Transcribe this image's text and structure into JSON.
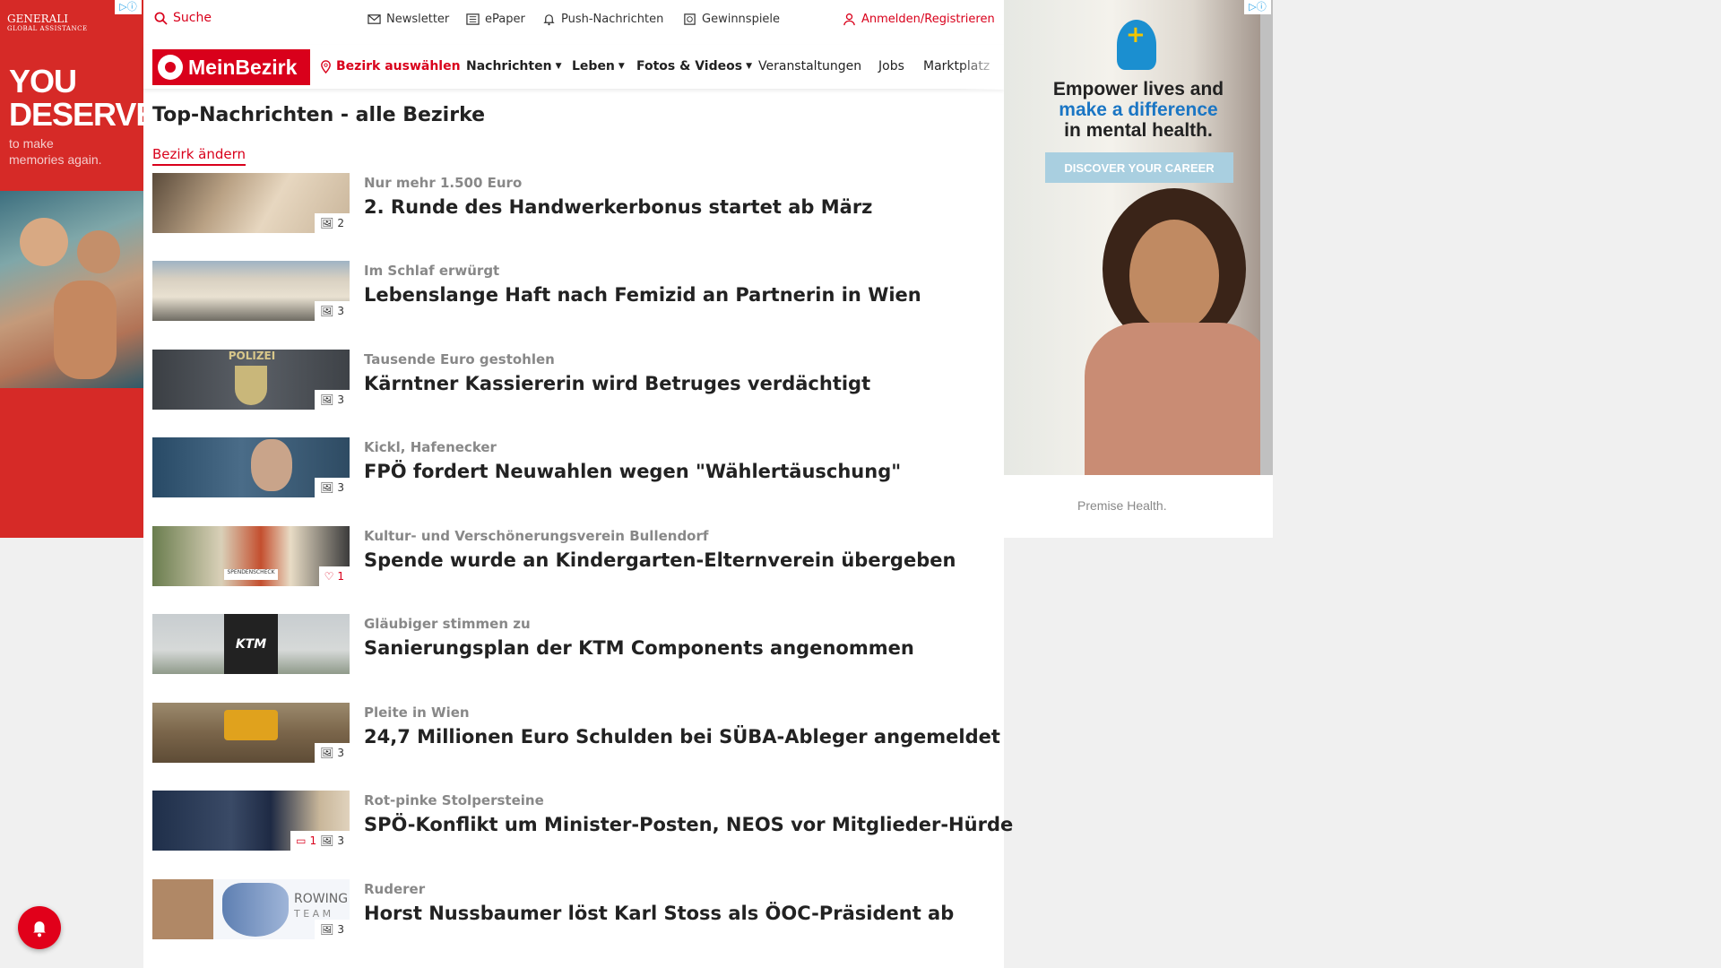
{
  "left_ad": {
    "brand": "GENERALI",
    "brand_sub": "GLOBAL ASSISTANCE",
    "headline_1": "YOU",
    "headline_2": "DESERVE",
    "sub_1": "to make",
    "sub_2": "memories again.",
    "adchoice": "▷ⓘ"
  },
  "topbar": {
    "search": "Suche",
    "newsletter": "Newsletter",
    "epaper": "ePaper",
    "push": "Push-Nachrichten",
    "gewinnspiele": "Gewinnspiele",
    "login": "Anmelden/Registrieren"
  },
  "nav": {
    "logo": "MeinBezirk",
    "bezirk": "Bezirk auswählen",
    "items": [
      "Nachrichten",
      "Leben",
      "Fotos & Videos",
      "Veranstaltungen",
      "Jobs",
      "Marktplatz"
    ]
  },
  "page": {
    "title": "Top-Nachrichten - alle Bezirke",
    "change_link": "Bezirk ändern"
  },
  "articles": [
    {
      "kicker": "Nur mehr 1.500 Euro",
      "headline": "2. Runde des Handwerkerbonus startet ab März",
      "images": "2",
      "comments": "",
      "likes": ""
    },
    {
      "kicker": "Im Schlaf erwürgt",
      "headline": "Lebenslange Haft nach Femizid an Partnerin in Wien",
      "images": "3",
      "comments": "",
      "likes": ""
    },
    {
      "kicker": "Tausende Euro gestohlen",
      "headline": "Kärntner Kassiererin wird Betruges verdächtigt",
      "images": "3",
      "comments": "",
      "likes": ""
    },
    {
      "kicker": "Kickl, Hafenecker",
      "headline": "FPÖ fordert Neuwahlen wegen \"Wählertäuschung\"",
      "images": "3",
      "comments": "",
      "likes": ""
    },
    {
      "kicker": "Kultur- und Verschönerungsverein Bullendorf",
      "headline": "Spende wurde an Kindergarten-Elternverein übergeben",
      "images": "",
      "comments": "",
      "likes": "1"
    },
    {
      "kicker": "Gläubiger stimmen zu",
      "headline": "Sanierungsplan der KTM Components angenommen",
      "images": "",
      "comments": "",
      "likes": ""
    },
    {
      "kicker": "Pleite in Wien",
      "headline": "24,7 Millionen Euro Schulden bei SÜBA-Ableger angemeldet",
      "images": "3",
      "comments": "",
      "likes": ""
    },
    {
      "kicker": "Rot-pinke Stolpersteine",
      "headline": "SPÖ-Konflikt um Minister-Posten, NEOS vor Mitglieder-Hürde",
      "images": "3",
      "comments": "1",
      "likes": ""
    },
    {
      "kicker": "Ruderer",
      "headline": "Horst Nussbaumer löst Karl Stoss als ÖOC-Präsident ab",
      "images": "3",
      "comments": "",
      "likes": ""
    }
  ],
  "thumb_texts": {
    "polizei": "POLIZEI",
    "ktm": "KTM",
    "rowing": "ROWING",
    "team": "T E A M",
    "spendenscheck": "SPENDENSCHECK"
  },
  "right_ad": {
    "line1": "Empower lives and",
    "line2": "make a difference",
    "line3": "in mental health.",
    "cta": "DISCOVER YOUR CAREER",
    "brand": "Premise Health.",
    "adchoice": "▷ⓘ"
  },
  "colors": {
    "brand_red": "#d9001b",
    "ad_red": "#d62a27",
    "ad_blue": "#1b76c4"
  }
}
